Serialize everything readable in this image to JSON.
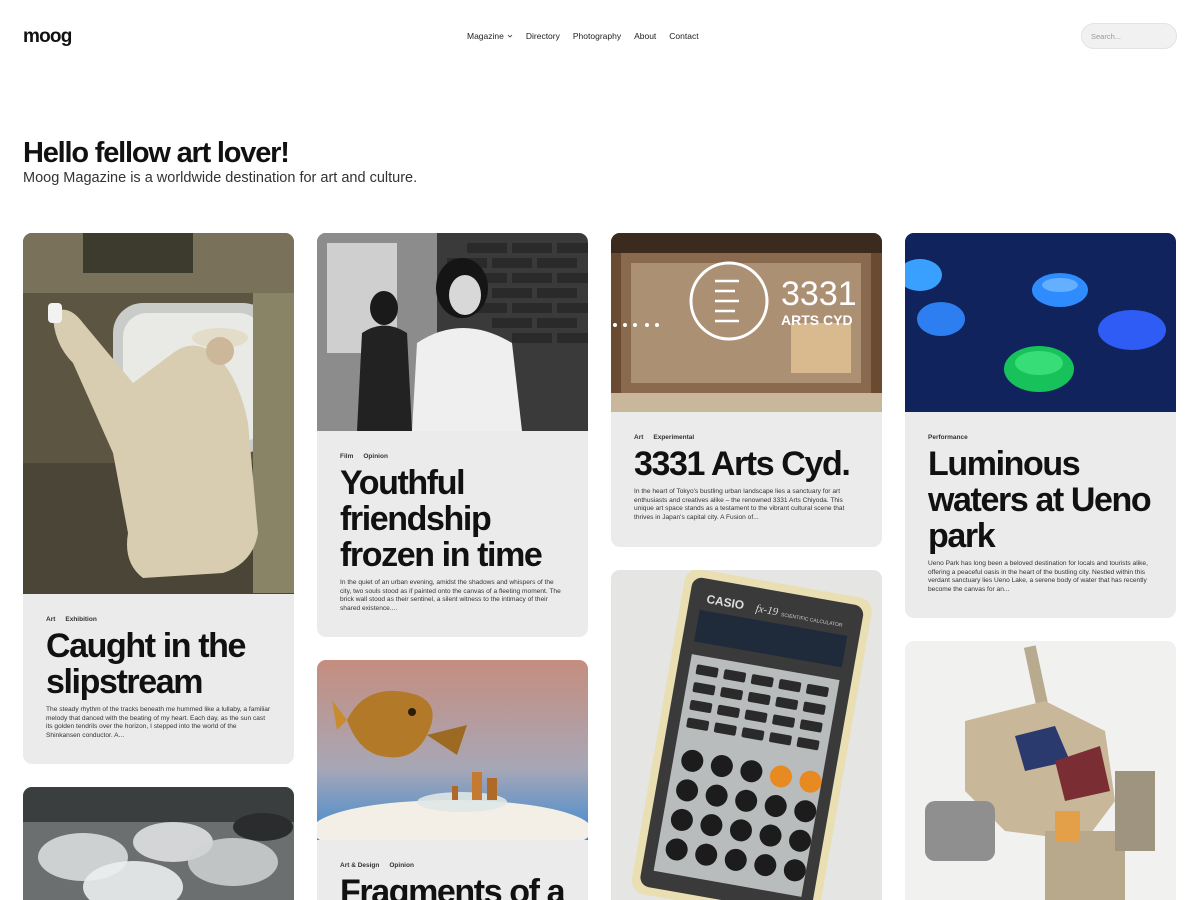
{
  "site": {
    "logo": "moog"
  },
  "nav": {
    "items": [
      "Magazine",
      "Directory",
      "Photography",
      "About",
      "Contact"
    ]
  },
  "search": {
    "placeholder": "Search..."
  },
  "hero": {
    "title": "Hello fellow art lover!",
    "subtitle": "Moog Magazine is a worldwide destination for art and culture."
  },
  "cards": [
    {
      "tags": [
        "Art",
        "Exhibition"
      ],
      "title": "Caught in the slipstream",
      "excerpt": "The steady rhythm of the tracks beneath me hummed like a lullaby, a familiar melody that danced with the beating of my heart. Each day, as the sun cast its golden tendrils over the horizon, I stepped into the world of the Shinkansen conductor. A..."
    },
    {
      "tags": [
        "Film",
        "Opinion"
      ],
      "title": "Youthful friendship frozen in time",
      "excerpt": "In the quiet of an urban evening, amidst the shadows and whispers of the city, two souls stood as if painted onto the canvas of a fleeting moment. The brick wall stood as their sentinel, a silent witness to the intimacy of their shared existence...."
    },
    {
      "tags": [
        "Art",
        "Experimental"
      ],
      "title": "3331 Arts Cyd.",
      "excerpt": "In the heart of Tokyo's bustling urban landscape lies a sanctuary for art enthusiasts and creatives alike – the renowned 3331 Arts Chiyoda. This unique art space stands as a testament to the vibrant cultural scene that thrives in Japan's capital city. A Fusion of...",
      "image_text": {
        "number": "3331",
        "name": "ARTS CYD"
      }
    },
    {
      "tags": [
        "Performance"
      ],
      "title": "Luminous waters at Ueno park",
      "excerpt": "Ueno Park has long been a beloved destination for locals and tourists alike, offering a peaceful oasis in the heart of the bustling city. Nestled within this verdant sanctuary lies Ueno Lake, a serene body of water that has recently become the canvas for an..."
    },
    {
      "tags": [
        "Art & Design",
        "Opinion"
      ],
      "title": "Fragments of a"
    },
    {
      "image_text": {
        "brand": "CASIO",
        "model": "fx-19",
        "caption": "SCIENTIFIC CALCULATOR"
      }
    }
  ]
}
